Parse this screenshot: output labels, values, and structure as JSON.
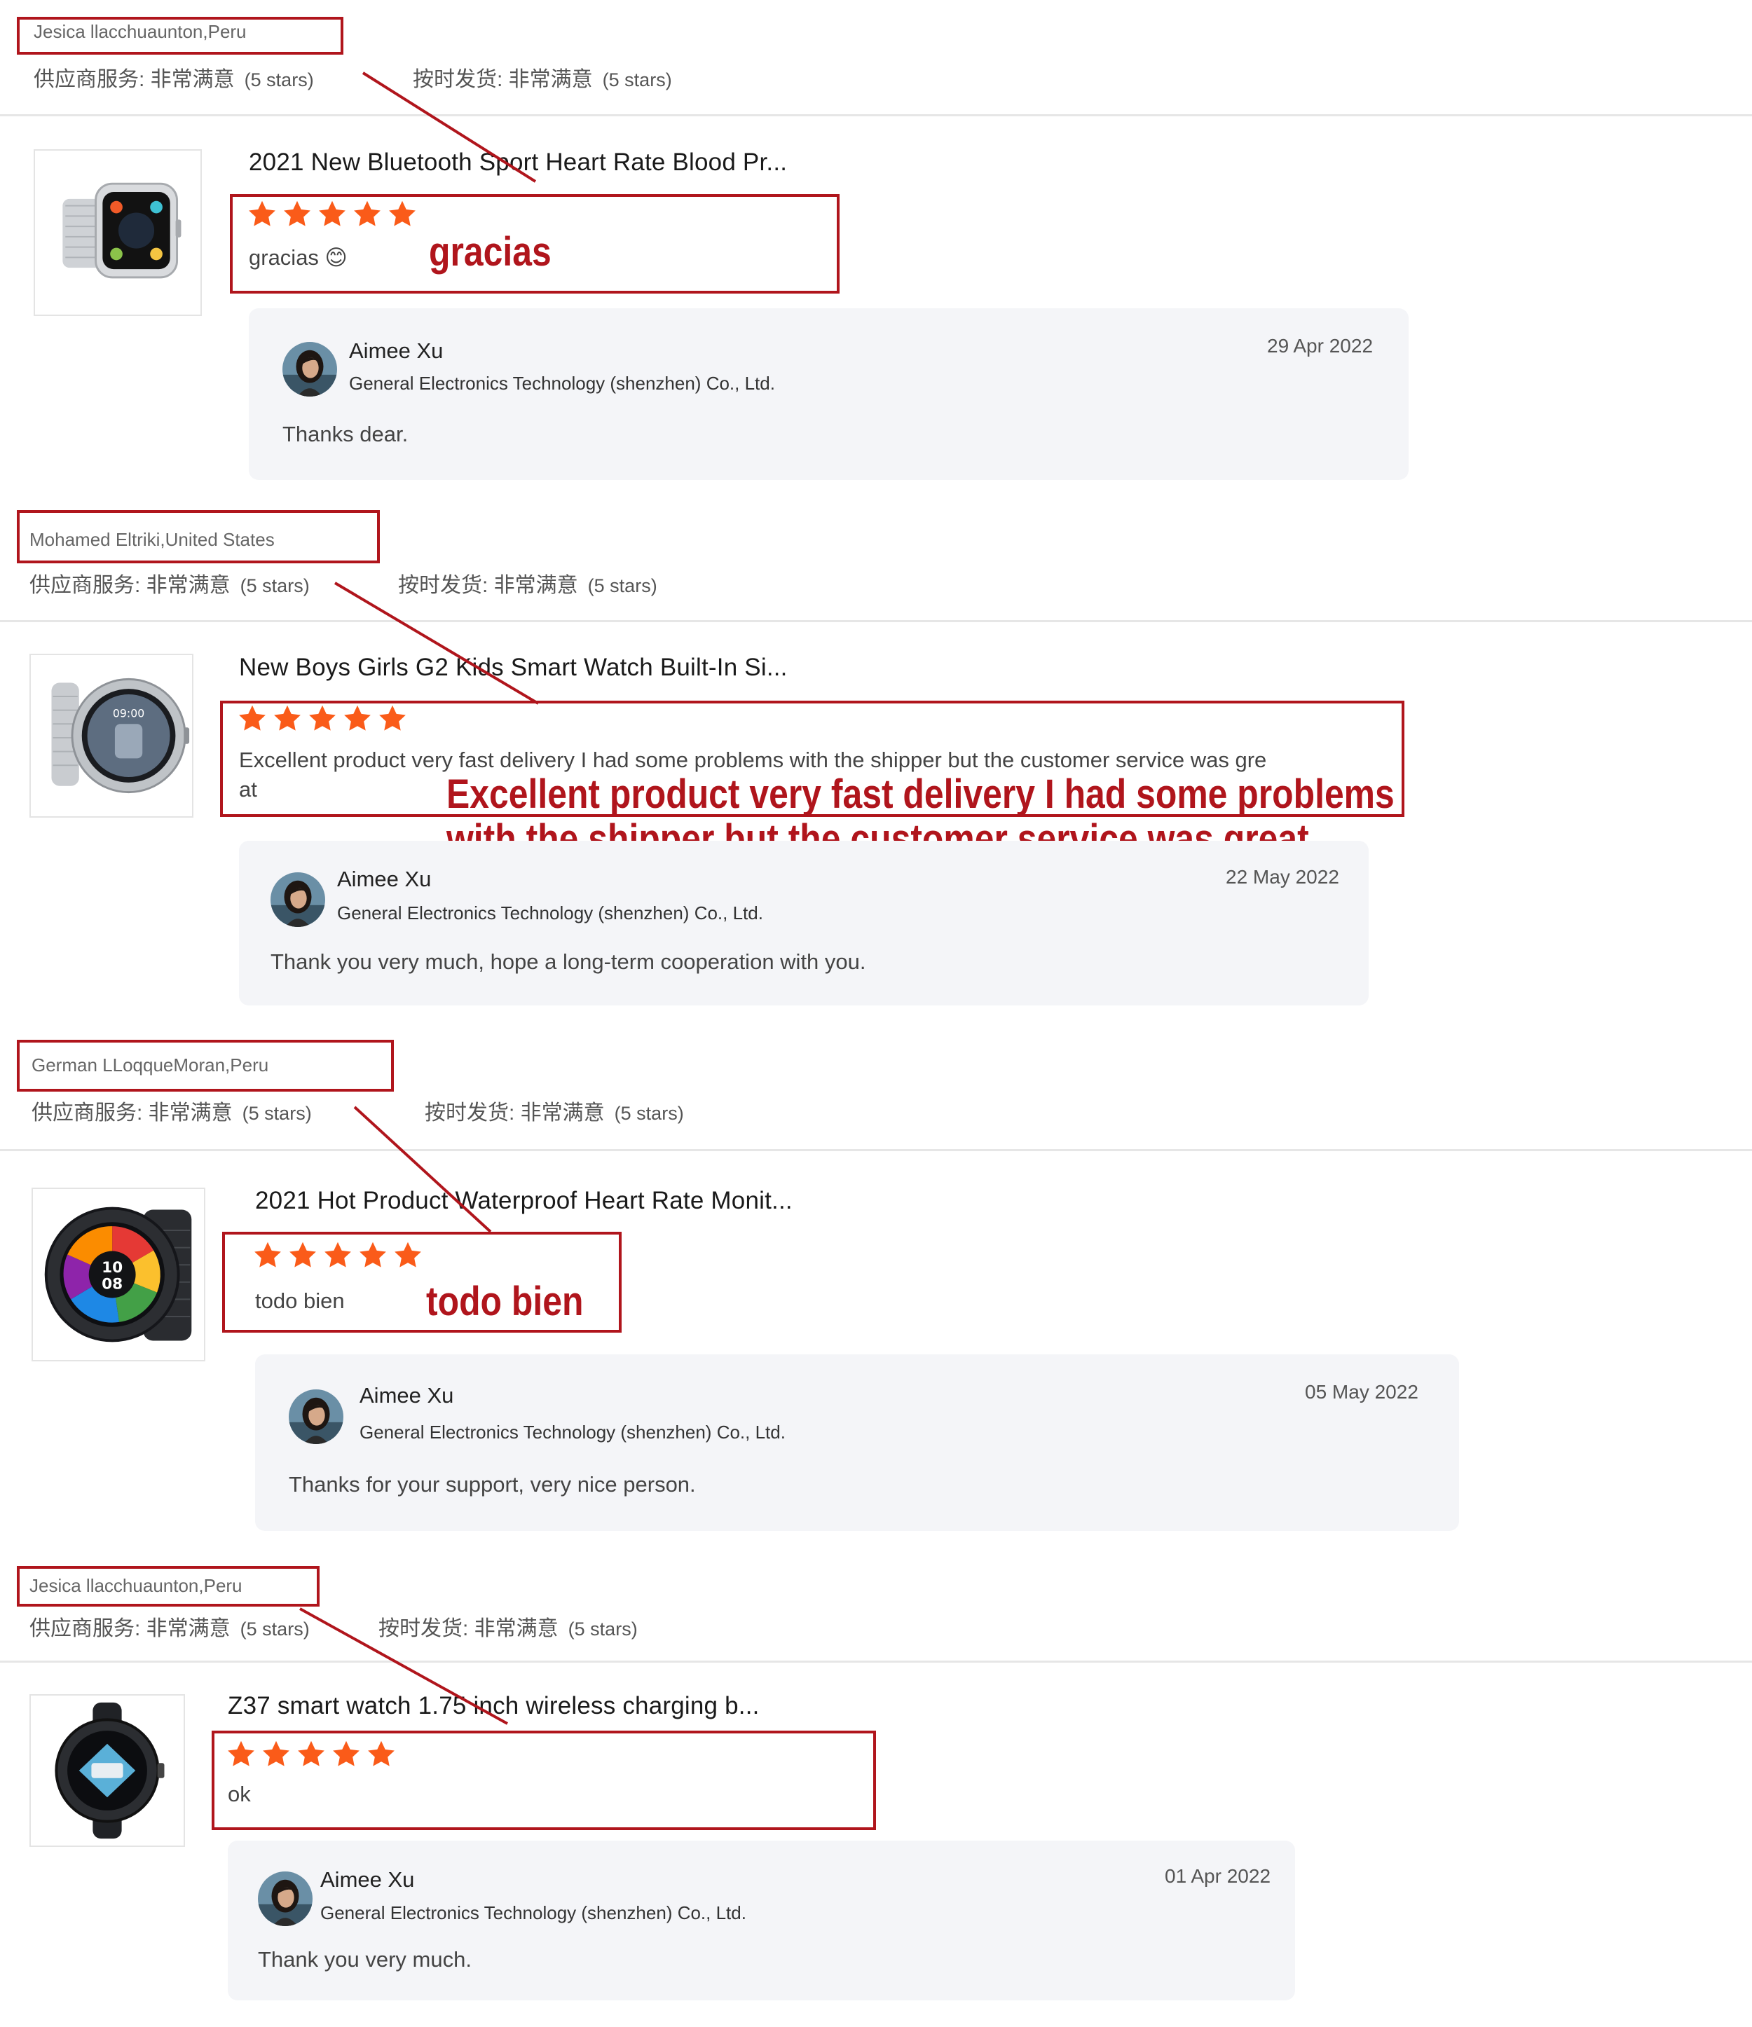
{
  "star_color": "#fa5b19",
  "annotation_color": "#b0151c",
  "reviews": [
    {
      "reviewer": "Jesica llacchuaunton,Peru",
      "supplier_service": "供应商服务: 非常满意",
      "supplier_stars": "(5 stars)",
      "on_time": "按时发货: 非常满意",
      "on_time_stars": "(5 stars)",
      "product_title": "2021 New Bluetooth Sport Heart Rate Blood Pr...",
      "product_icon": "smartwatch-square-silver-mesh",
      "rating": 5,
      "comment": "gracias 😊",
      "translation": "gracias",
      "reply": {
        "seller": "Aimee Xu",
        "company": "General Electronics Technology (shenzhen) Co., Ltd.",
        "date": "29 Apr 2022",
        "text": "Thanks dear."
      }
    },
    {
      "reviewer": "Mohamed Eltriki,United States",
      "supplier_service": "供应商服务: 非常满意",
      "supplier_stars": "(5 stars)",
      "on_time": "按时发货: 非常满意",
      "on_time_stars": "(5 stars)",
      "product_title": "New Boys Girls G2 Kids Smart Watch Built-In Si...",
      "product_icon": "smartwatch-round-silver-mesh",
      "rating": 5,
      "comment_line1": "Excellent product very fast delivery I had some problems with the shipper but the customer service was gre",
      "comment_line2": "at",
      "translation_line1": "Excellent product very fast delivery I had some problems",
      "translation_line2": "with the shipper but the customer service was great",
      "reply": {
        "seller": "Aimee Xu",
        "company": "General Electronics Technology (shenzhen) Co., Ltd.",
        "date": "22 May 2022",
        "text": "Thank you very much, hope a long-term cooperation with you."
      }
    },
    {
      "reviewer": "German LLoqqueMoran,Peru",
      "supplier_service": "供应商服务: 非常满意",
      "supplier_stars": "(5 stars)",
      "on_time": "按时发货: 非常满意",
      "on_time_stars": "(5 stars)",
      "product_title": "2021 Hot Product Waterproof Heart Rate Monit...",
      "product_icon": "smartwatch-round-black-mesh",
      "rating": 5,
      "comment": "todo bien",
      "translation": "todo bien",
      "reply": {
        "seller": "Aimee Xu",
        "company": "General Electronics Technology (shenzhen) Co., Ltd.",
        "date": "05 May 2022",
        "text": "Thanks for your support, very nice person."
      }
    },
    {
      "reviewer": "Jesica llacchuaunton,Peru",
      "supplier_service": "供应商服务: 非常满意",
      "supplier_stars": "(5 stars)",
      "on_time": "按时发货: 非常满意",
      "on_time_stars": "(5 stars)",
      "product_title": "Z37 smart watch 1.75 inch wireless charging b...",
      "product_icon": "smartwatch-round-black-strap",
      "rating": 5,
      "comment": "ok",
      "reply": {
        "seller": "Aimee Xu",
        "company": "General Electronics Technology (shenzhen) Co., Ltd.",
        "date": "01 Apr 2022",
        "text": "Thank you very much."
      }
    }
  ]
}
